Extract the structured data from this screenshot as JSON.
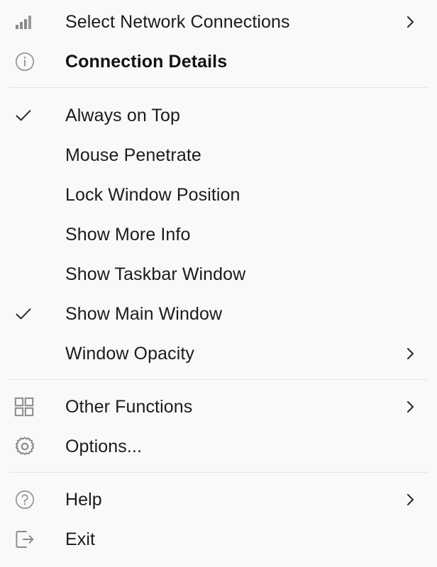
{
  "menu": {
    "background_color": "#f9f9f9",
    "text_color": "#1b1b1f",
    "icon_color": "#8a8a8a",
    "separator_color": "#e2e2e2",
    "sections": [
      {
        "name": "connection",
        "items": [
          {
            "label": "Select Network Connections",
            "icon": "signal-bars-icon",
            "has_submenu": true,
            "checked": false,
            "bold": false
          },
          {
            "label": "Connection Details",
            "icon": "info-circle-icon",
            "has_submenu": false,
            "checked": false,
            "bold": true
          }
        ]
      },
      {
        "name": "window-options",
        "items": [
          {
            "label": "Always on Top",
            "icon": null,
            "has_submenu": false,
            "checked": true,
            "bold": false
          },
          {
            "label": "Mouse Penetrate",
            "icon": null,
            "has_submenu": false,
            "checked": false,
            "bold": false
          },
          {
            "label": "Lock Window Position",
            "icon": null,
            "has_submenu": false,
            "checked": false,
            "bold": false
          },
          {
            "label": "Show More Info",
            "icon": null,
            "has_submenu": false,
            "checked": false,
            "bold": false
          },
          {
            "label": "Show Taskbar Window",
            "icon": null,
            "has_submenu": false,
            "checked": false,
            "bold": false
          },
          {
            "label": "Show Main Window",
            "icon": null,
            "has_submenu": false,
            "checked": true,
            "bold": false
          },
          {
            "label": "Window Opacity",
            "icon": null,
            "has_submenu": true,
            "checked": false,
            "bold": false
          }
        ]
      },
      {
        "name": "functions",
        "items": [
          {
            "label": "Other Functions",
            "icon": "grid-squares-icon",
            "has_submenu": true,
            "checked": false,
            "bold": false
          },
          {
            "label": "Options...",
            "icon": "gear-icon",
            "has_submenu": false,
            "checked": false,
            "bold": false
          }
        ]
      },
      {
        "name": "help-exit",
        "items": [
          {
            "label": "Help",
            "icon": "help-circle-icon",
            "has_submenu": true,
            "checked": false,
            "bold": false
          },
          {
            "label": "Exit",
            "icon": "sign-out-icon",
            "has_submenu": false,
            "checked": false,
            "bold": false
          }
        ]
      }
    ]
  }
}
